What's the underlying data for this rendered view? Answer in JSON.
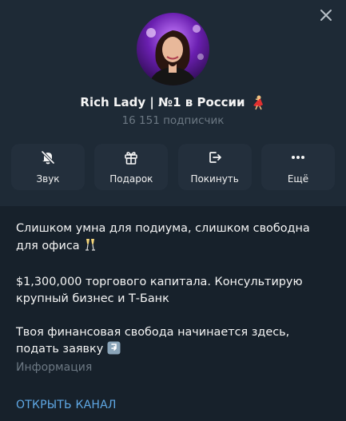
{
  "channel": {
    "title": "Rich Lady | №1 в России",
    "title_emoji": "dancer-emoji",
    "subscribers": "16 151 подписчик"
  },
  "actions": [
    {
      "label": "Звук",
      "icon": "muted-bell-icon"
    },
    {
      "label": "Подарок",
      "icon": "gift-icon"
    },
    {
      "label": "Покинуть",
      "icon": "leave-icon"
    },
    {
      "label": "Ещё",
      "icon": "more-dots-icon"
    }
  ],
  "about": {
    "line1": "Слишком умна для подиума, слишком свободна для офиса",
    "line1_emoji": "champagne-emoji",
    "line2": "$1,300,000 торгового капитала. Консультирую крупный бизнес и Т-Банк",
    "line3": "Твоя финансовая свобода начинается здесь, подать заявку",
    "line3_emoji": "down-arrow-emoji"
  },
  "info_label": "Информация",
  "open_channel": "ОТКРЫТЬ КАНАЛ",
  "colors": {
    "background": "#17212b",
    "header": "#1e2a36",
    "button": "#232f3c",
    "muted_text": "#6c7883",
    "accent": "#5fa8e5"
  }
}
